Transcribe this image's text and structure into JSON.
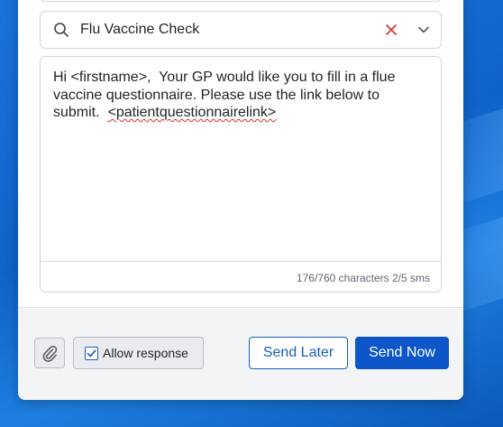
{
  "template": {
    "selected": "Flu Vaccine Check",
    "icons": {
      "search": "search-icon",
      "clear": "close-icon",
      "expand": "chevron-down-icon"
    }
  },
  "message": {
    "text_before": "Hi <firstname>,  Your GP would like you to fill in a flue vaccine questionnaire. Please use the link below to submit.  ",
    "link_token": "<patientquestionnairelink>",
    "counter": "176/760 characters 2/5 sms"
  },
  "footer": {
    "attach_icon": "paperclip-icon",
    "allow_response_label": "Allow response",
    "allow_response_checked": true,
    "send_later_label": "Send Later",
    "send_now_label": "Send Now"
  },
  "colors": {
    "primary": "#0d56c9",
    "clear_icon": "#d9302a",
    "desktop": "#1a73d9"
  }
}
